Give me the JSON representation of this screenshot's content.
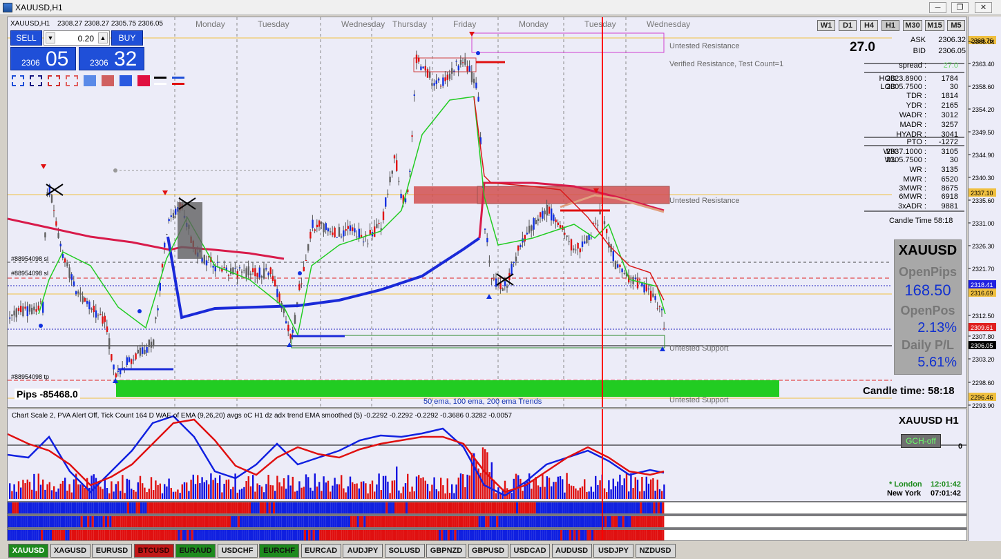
{
  "window": {
    "title": "XAUUSD,H1"
  },
  "ohlc_header": "2308.27 2308.27 2305.75 2306.05",
  "timeframes": [
    "W1",
    "D1",
    "H4",
    "H1",
    "M30",
    "M15",
    "M5"
  ],
  "active_timeframe": "H1",
  "day_labels": [
    "Monday",
    "Tuesday",
    "Wednesday",
    "Thursday",
    "Friday",
    "Monday",
    "Tuesday",
    "Wednesday"
  ],
  "trade_ticket": {
    "sell_label": "SELL",
    "buy_label": "BUY",
    "lots": "0.20",
    "sell_small": "2306",
    "sell_big": "05",
    "buy_small": "2306",
    "buy_big": "32"
  },
  "spread_big": "27.0",
  "market_info": [
    {
      "k": "ASK",
      "v": "2306.32"
    },
    {
      "k": "BID",
      "v": "2306.05"
    },
    {
      "k": "spread :",
      "v": "27.0"
    },
    {
      "k": "HOD",
      "v2": "2323.8900 :",
      "v": "1784"
    },
    {
      "k": "LOD",
      "v2": "2305.7500 :",
      "v": "30"
    },
    {
      "k": "TDR :",
      "v": "1814"
    },
    {
      "k": "YDR :",
      "v": "2165"
    },
    {
      "k": "WADR :",
      "v": "3012"
    },
    {
      "k": "MADR :",
      "v": "3257"
    },
    {
      "k": "HYADR :",
      "v": "3041"
    },
    {
      "k": "PTO :",
      "v": "-1272"
    },
    {
      "k": "WH",
      "v2": "2337.1000 :",
      "v": "3105"
    },
    {
      "k": "WL",
      "v2": "2305.7500 :",
      "v": "30"
    },
    {
      "k": "WR :",
      "v": "3135"
    },
    {
      "k": "MWR :",
      "v": "6520"
    },
    {
      "k": "3MWR :",
      "v": "8675"
    },
    {
      "k": "6MWR :",
      "v": "6918"
    },
    {
      "k": "3xADR :",
      "v": "9881"
    }
  ],
  "candle_time_small": "Candle Time   58:18",
  "candle_time_big": "Candle time:  58:18",
  "stats_box": {
    "symbol": "XAUUSD",
    "l1": "OpenPips",
    "v1": "168.50",
    "l2": "OpenPos",
    "v2": "2.13%",
    "l3": "Daily P/L",
    "v3": "5.61%"
  },
  "zones": {
    "r1": "Untested Resistance",
    "r2": "Verified Resistance, Test Count=1",
    "r3": "Untested Resistance",
    "s1": "Untested Support",
    "s2": "Untested Support"
  },
  "order_labels": [
    "#88954098 sl",
    "#88954098 sl",
    "#88954098 tp"
  ],
  "pips": "Pips -85468.0",
  "ema_label": "50 ema, 100 ema, 200 ema Trends",
  "price_axis": [
    "2368.76",
    "2366.04",
    "2363.40",
    "2358.60",
    "2354.20",
    "2349.50",
    "2344.90",
    "2340.30",
    "2337.10",
    "2335.60",
    "2331.00",
    "2326.30",
    "2321.70",
    "2318.41",
    "2316.69",
    "2312.50",
    "2309.61",
    "2307.80",
    "2306.05",
    "2303.20",
    "2298.60",
    "2296.46",
    "2293.90"
  ],
  "price_axis_highlight": {
    "2368.76": "#f0c040",
    "2337.10": "#f0c040",
    "2318.41": "#2020e0",
    "2316.69": "#f0c040",
    "2309.61": "#e02020",
    "2306.05": "#000000",
    "2296.46": "#f0c040"
  },
  "indicator": {
    "header": "Chart Scale  2,   PVA Alert Off,   Tick Count  164   D WAE of EMA (9,26,20)   avgs oC H1 dz adx trend EMA smoothed (5) -0.2292 -0.2292 -0.2292 -0.3686 0.3282 -0.0057",
    "title": "XAUUSD  H1",
    "gch": "GCH-off",
    "london": "* London",
    "london_time": "12:01:42",
    "ny": "New York",
    "ny_time": "07:01:42",
    "zero": "0"
  },
  "symbol_tabs": [
    {
      "label": "XAUUSD",
      "bg": "#1e8a1e",
      "fg": "#fff"
    },
    {
      "label": "XAGUSD",
      "bg": "#d8d8d8",
      "fg": "#111"
    },
    {
      "label": "EURUSD",
      "bg": "#d8d8d8",
      "fg": "#111"
    },
    {
      "label": "BTCUSD",
      "bg": "#c01818",
      "fg": "#300"
    },
    {
      "label": "EURAUD",
      "bg": "#1e8a1e",
      "fg": "#111"
    },
    {
      "label": "USDCHF",
      "bg": "#d8d8d8",
      "fg": "#111"
    },
    {
      "label": "EURCHF",
      "bg": "#1e8a1e",
      "fg": "#111"
    },
    {
      "label": "EURCAD",
      "bg": "#d8d8d8",
      "fg": "#111"
    },
    {
      "label": "AUDJPY",
      "bg": "#d8d8d8",
      "fg": "#111"
    },
    {
      "label": "SOLUSD",
      "bg": "#d8d8d8",
      "fg": "#111"
    },
    {
      "label": "GBPNZD",
      "bg": "#d8d8d8",
      "fg": "#111"
    },
    {
      "label": "GBPUSD",
      "bg": "#d8d8d8",
      "fg": "#111"
    },
    {
      "label": "USDCAD",
      "bg": "#d8d8d8",
      "fg": "#111"
    },
    {
      "label": "AUDUSD",
      "bg": "#d8d8d8",
      "fg": "#111"
    },
    {
      "label": "USDJPY",
      "bg": "#d8d8d8",
      "fg": "#111"
    },
    {
      "label": "NZDUSD",
      "bg": "#d8d8d8",
      "fg": "#111"
    }
  ],
  "colors": {
    "bull": "#1030e0",
    "bear": "#e01010",
    "support_zone": "#22cc22",
    "resistance_zone": "#d25050",
    "vline": "#ff0000"
  },
  "window_buttons": [
    "minimize-icon",
    "restore-icon",
    "close-icon"
  ]
}
